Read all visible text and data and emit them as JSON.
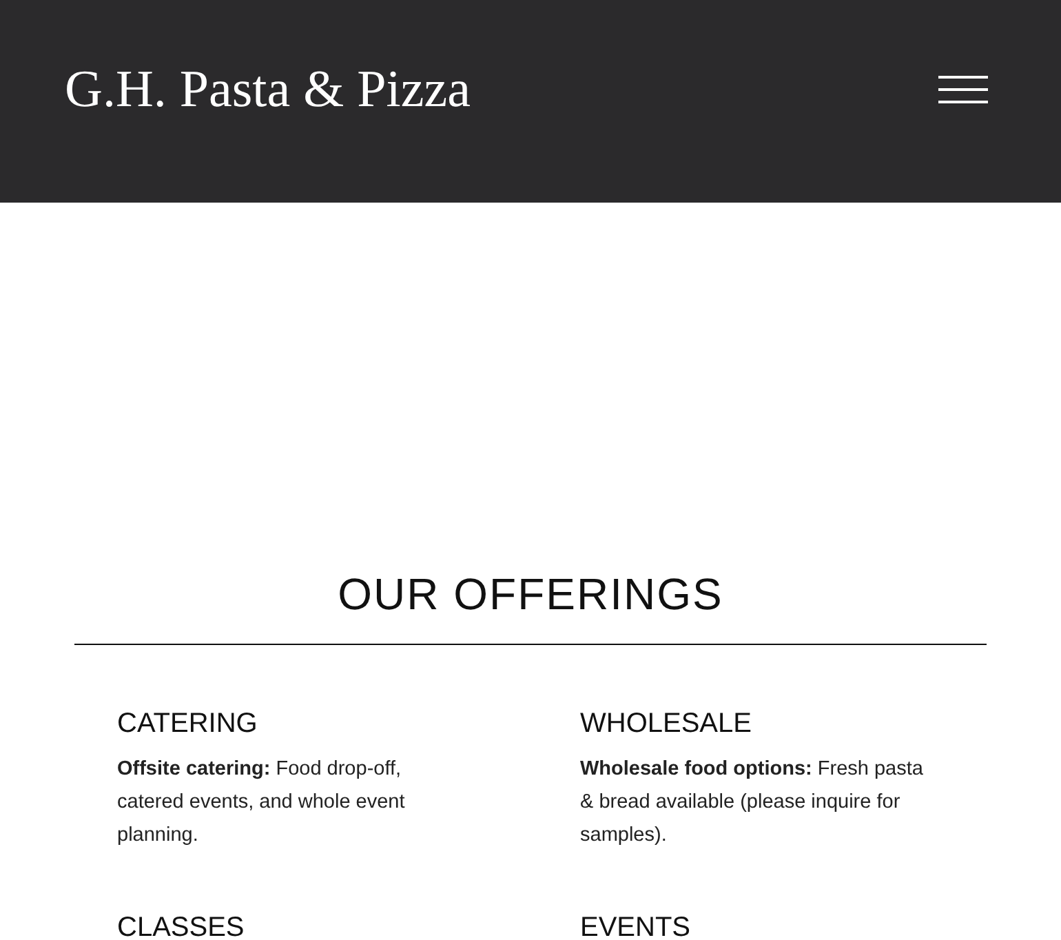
{
  "header": {
    "logo": "G.H. Pasta & Pizza"
  },
  "offerings": {
    "title": "OUR OFFERINGS",
    "items": [
      {
        "heading": "CATERING",
        "text": "**Offsite catering:** Food drop-off, catered events, and whole event planning."
      },
      {
        "heading": "WHOLESALE",
        "text": "**Wholesale food options:** Fresh pasta & bread available (please inquire for samples)."
      },
      {
        "heading": "CLASSES"
      },
      {
        "heading": "EVENTS"
      }
    ]
  }
}
